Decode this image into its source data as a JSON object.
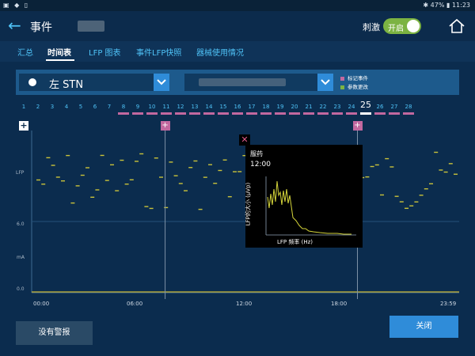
{
  "status_bar": {
    "time": "11:23",
    "battery": "47%"
  },
  "header": {
    "title": "事件",
    "stim_label": "刺激",
    "stim_toggle": "开启"
  },
  "tabs": [
    "汇总",
    "时间表",
    "LFP 图表",
    "事件LFP快照",
    "器械使用情况"
  ],
  "active_tab": 1,
  "selector": {
    "hemisphere": "左 STN"
  },
  "legend": [
    {
      "label": "标记事件",
      "color": "#c2689f"
    },
    {
      "label": "参数更改",
      "color": "#7cb342"
    }
  ],
  "days": [
    "1",
    "2",
    "3",
    "4",
    "5",
    "6",
    "7",
    "8",
    "9",
    "10",
    "11",
    "12",
    "13",
    "14",
    "15",
    "16",
    "17",
    "18",
    "19",
    "20",
    "21",
    "22",
    "23",
    "24",
    "25",
    "26",
    "27",
    "28"
  ],
  "current_day": "25",
  "chart_data": {
    "type": "scatter",
    "ylabel_top": "LFP",
    "ylabel_bottom": "mA",
    "y_ticks_bottom": [
      "6.0",
      "0.0"
    ],
    "x_ticks": [
      "00:00",
      "06:00",
      "12:00",
      "18:00",
      "23:59"
    ],
    "event_markers_hours": [
      7.0,
      18.0
    ]
  },
  "popup": {
    "event": "服药",
    "time": "12:00",
    "ylabel": "LFP的大小 (µVp)",
    "xlabel": "LFP 频率 (Hz)"
  },
  "buttons": {
    "no_alarm": "没有警报",
    "close": "关闭"
  }
}
